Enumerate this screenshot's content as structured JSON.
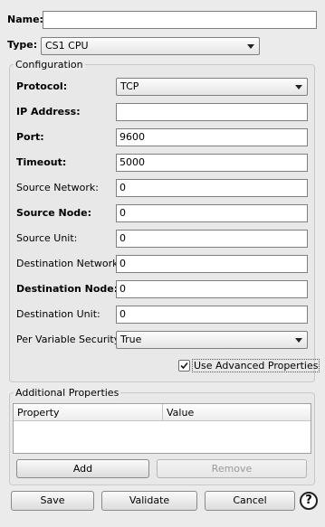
{
  "name": {
    "label": "Name:",
    "value": ""
  },
  "type": {
    "label": "Type:",
    "value": "CS1 CPU"
  },
  "configuration": {
    "title": "Configuration",
    "protocol": {
      "label": "Protocol:",
      "value": "TCP"
    },
    "ip_address": {
      "label": "IP Address:",
      "value": ""
    },
    "port": {
      "label": "Port:",
      "value": "9600"
    },
    "timeout": {
      "label": "Timeout:",
      "value": "5000"
    },
    "source_network": {
      "label": "Source Network:",
      "value": "0"
    },
    "source_node": {
      "label": "Source Node:",
      "value": "0"
    },
    "source_unit": {
      "label": "Source Unit:",
      "value": "0"
    },
    "destination_network": {
      "label": "Destination Network:",
      "value": "0"
    },
    "destination_node": {
      "label": "Destination Node:",
      "value": "0"
    },
    "destination_unit": {
      "label": "Destination Unit:",
      "value": "0"
    },
    "per_variable_security": {
      "label": "Per Variable Security:",
      "value": "True"
    },
    "advanced": {
      "label": "Use Advanced Properties",
      "checked": true
    }
  },
  "additional": {
    "title": "Additional Properties",
    "columns": [
      "Property",
      "Value"
    ],
    "add_label": "Add",
    "remove_label": "Remove"
  },
  "footer": {
    "save_label": "Save",
    "validate_label": "Validate",
    "cancel_label": "Cancel",
    "help_glyph": "?"
  }
}
